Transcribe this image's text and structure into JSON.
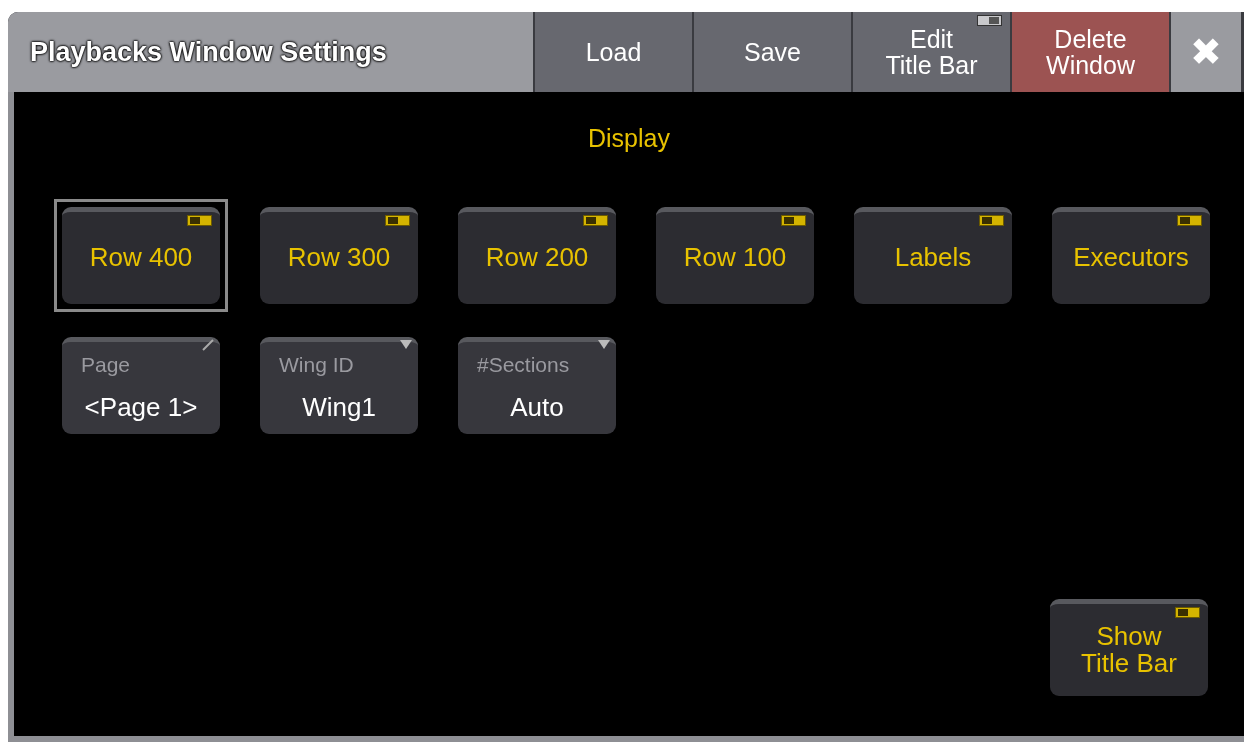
{
  "window": {
    "title": "Playbacks Window Settings"
  },
  "title_bar_buttons": [
    {
      "kind": "plain",
      "label": "Load"
    },
    {
      "kind": "plain",
      "label": "Save"
    },
    {
      "kind": "toggle",
      "label": "Edit\nTitle Bar",
      "on": false
    },
    {
      "kind": "danger",
      "label": "Delete\nWindow"
    },
    {
      "kind": "close",
      "label": "✖"
    }
  ],
  "section": {
    "heading": "Display"
  },
  "toggles": [
    {
      "label": "Row 400",
      "on": true,
      "selected": true
    },
    {
      "label": "Row 300",
      "on": true,
      "selected": false
    },
    {
      "label": "Row 200",
      "on": true,
      "selected": false
    },
    {
      "label": "Row 100",
      "on": true,
      "selected": false
    },
    {
      "label": "Labels",
      "on": true,
      "selected": false
    },
    {
      "label": "Executors",
      "on": true,
      "selected": false
    }
  ],
  "fields": [
    {
      "kind": "edit",
      "label": "Page",
      "value": "<Page 1>"
    },
    {
      "kind": "dropdown",
      "label": "Wing ID",
      "value": "Wing1"
    },
    {
      "kind": "dropdown",
      "label": "#Sections",
      "value": "Auto"
    }
  ],
  "show_title_bar": {
    "label": "Show\nTitle Bar",
    "on": true
  }
}
